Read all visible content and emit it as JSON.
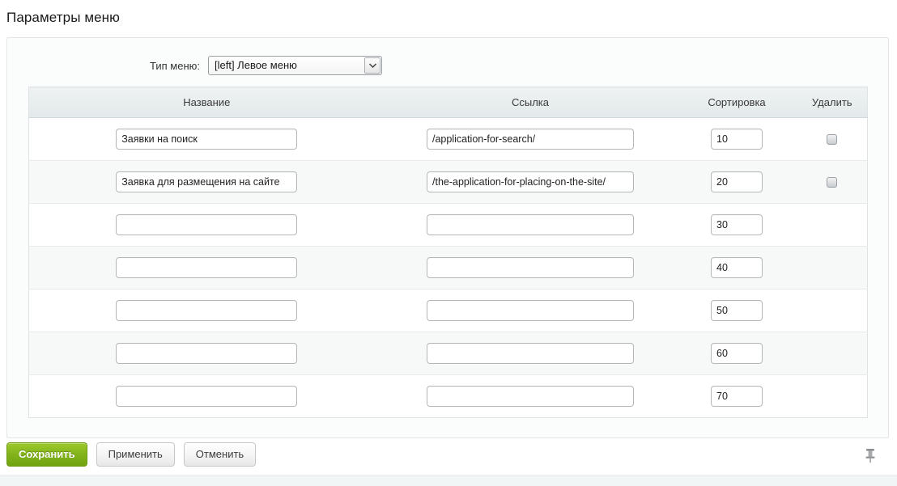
{
  "page": {
    "title": "Параметры меню"
  },
  "menu_type": {
    "label": "Тип меню:",
    "selected": "[left] Левое меню",
    "options": [
      "[left] Левое меню"
    ],
    "arrow_icon": "chevron-down-icon"
  },
  "table": {
    "headers": {
      "name": "Название",
      "link": "Ссылка",
      "sort": "Сортировка",
      "delete": "Удалить"
    },
    "rows": [
      {
        "name": "Заявки на поиск",
        "link": "/application-for-search/",
        "sort": "10",
        "has_delete": true
      },
      {
        "name": "Заявка для размещения на сайте",
        "link": "/the-application-for-placing-on-the-site/",
        "sort": "20",
        "has_delete": true
      },
      {
        "name": "",
        "link": "",
        "sort": "30",
        "has_delete": false
      },
      {
        "name": "",
        "link": "",
        "sort": "40",
        "has_delete": false
      },
      {
        "name": "",
        "link": "",
        "sort": "50",
        "has_delete": false
      },
      {
        "name": "",
        "link": "",
        "sort": "60",
        "has_delete": false
      },
      {
        "name": "",
        "link": "",
        "sort": "70",
        "has_delete": false
      }
    ]
  },
  "footer": {
    "save_label": "Сохранить",
    "apply_label": "Применить",
    "cancel_label": "Отменить",
    "pin_icon": "pushpin-icon"
  },
  "colors": {
    "primary_button": "#82b31c",
    "panel_border": "#e2e6e8",
    "table_header": "#e9eef0",
    "row_stripe": "#f7f9f9"
  }
}
